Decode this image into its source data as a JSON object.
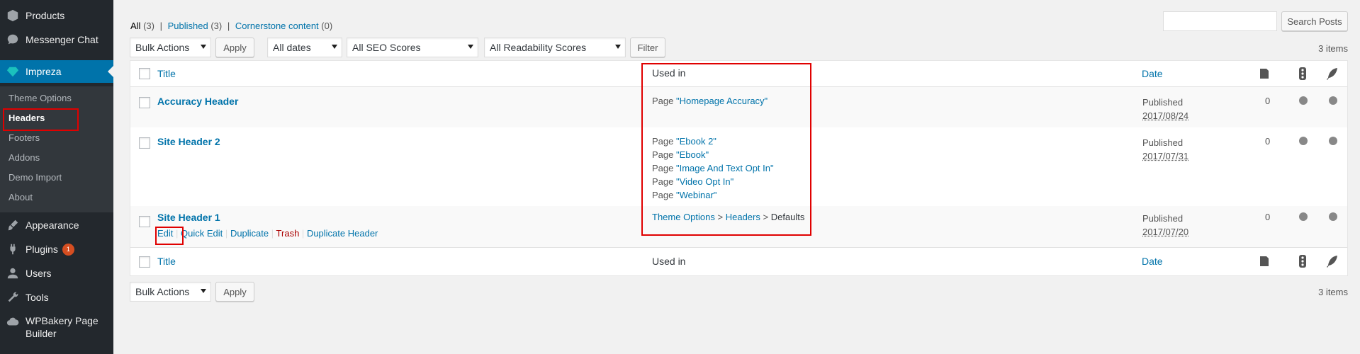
{
  "sidebar": {
    "items": [
      {
        "label": "Products",
        "icon": "box-icon"
      },
      {
        "label": "Messenger Chat",
        "icon": "chat-bubble-icon"
      },
      {
        "label": "Impreza",
        "icon": "diamond-icon"
      },
      {
        "label": "Appearance",
        "icon": "brush-icon"
      },
      {
        "label": "Plugins",
        "icon": "plug-icon",
        "badge": "1"
      },
      {
        "label": "Users",
        "icon": "user-icon"
      },
      {
        "label": "Tools",
        "icon": "wrench-icon"
      },
      {
        "label": "WPBakery Page Builder",
        "icon": "cloud-icon"
      }
    ],
    "submenu": [
      "Theme Options",
      "Headers",
      "Footers",
      "Addons",
      "Demo Import",
      "About"
    ],
    "active_submenu": "Headers"
  },
  "filters": {
    "all": "All",
    "all_count": "(3)",
    "published": "Published",
    "published_count": "(3)",
    "cornerstone": "Cornerstone content",
    "cornerstone_count": "(0)",
    "sep": "|"
  },
  "search": {
    "button": "Search Posts",
    "value": ""
  },
  "toolbar": {
    "bulk_actions": "Bulk Actions",
    "apply": "Apply",
    "dates": "All dates",
    "seo": "All SEO Scores",
    "readability": "All Readability Scores",
    "filter": "Filter",
    "items_count": "3 items"
  },
  "table": {
    "columns": {
      "title": "Title",
      "used_in": "Used in",
      "date": "Date"
    },
    "column_icons": [
      "seo-score-icon",
      "traffic-light-icon",
      "feather-icon"
    ],
    "rows": [
      {
        "title": "Accuracy Header",
        "used_in": [
          {
            "prefix": "Page ",
            "link": "\"Homepage Accuracy\""
          }
        ],
        "status": "Published",
        "date": "2017/08/24",
        "count": "0"
      },
      {
        "title": "Site Header 2",
        "used_in": [
          {
            "prefix": "Page ",
            "link": "\"Ebook 2\""
          },
          {
            "prefix": "Page ",
            "link": "\"Ebook\""
          },
          {
            "prefix": "Page ",
            "link": "\"Image And Text Opt In\""
          },
          {
            "prefix": "Page ",
            "link": "\"Video Opt In\""
          },
          {
            "prefix": "Page ",
            "link": "\"Webinar\""
          }
        ],
        "status": "Published",
        "date": "2017/07/31",
        "count": "0"
      },
      {
        "title": "Site Header 1",
        "used_in_breadcrumb": {
          "a": "Theme Options",
          "gt1": ">",
          "b": "Headers",
          "gt2": ">",
          "c": "Defaults"
        },
        "status": "Published",
        "date": "2017/07/20",
        "count": "0",
        "actions": {
          "edit": "Edit",
          "quick_edit": "Quick Edit",
          "duplicate": "Duplicate",
          "trash": "Trash",
          "duplicate_header": "Duplicate Header",
          "sep": "|"
        }
      }
    ]
  },
  "bottom": {
    "bulk_actions": "Bulk Actions",
    "apply": "Apply",
    "items_count": "3 items"
  },
  "colors": {
    "accent": "#0073aa",
    "sidebar_bg": "#23282d",
    "highlight": "#e00000",
    "trash": "#a00000"
  }
}
